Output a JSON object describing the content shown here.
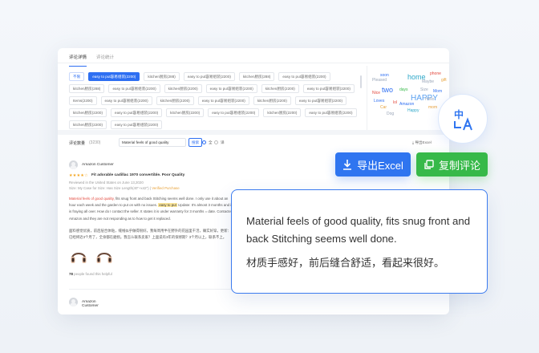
{
  "tabs": [
    {
      "label": "评论详情"
    },
    {
      "label": "评论统计"
    }
  ],
  "tags": [
    "不限",
    "easy to put容易组装(2200)",
    "kitchen厨房(288)",
    "easy to put容易组装(2200)",
    "kitchen厨房(288)",
    "easy to put容易组装(2200)",
    "kitchen厨房(288)",
    "easy to put容易组装(2200)",
    "kitchen厨房(2200)",
    "easy to put容易组装(2200)",
    "kitchen厨房(2200)",
    "easy to put容易组装(2200)",
    "Items(2200)",
    "easy to put容易组装(2200)",
    "kitchen厨房(2200)",
    "easy to put容易组装(2200)",
    "kitchen厨房(2200)",
    "easy to put容易组装(2200)",
    "kitchen厨房(2200)",
    "easy to put容易组装(2200)",
    "kitchen厨房(2200)",
    "easy to put容易组装(2200)",
    "kitchen厨房(2200)",
    "easy to put容易组装(2200)",
    "kitchen厨房(2200)",
    "easy to put容易组装(2200)"
  ],
  "wordcloud": {
    "words": [
      {
        "text": "Pleased",
        "color": "#9aa6b8"
      },
      {
        "text": "soon",
        "color": "#2e6ff2"
      },
      {
        "text": "home",
        "color": "#2ea8c9"
      },
      {
        "text": "phone",
        "color": "#e2483d"
      },
      {
        "text": "Maybe",
        "color": "#9aa6b8"
      },
      {
        "text": "gift",
        "color": "#e8a23a"
      },
      {
        "text": "Mom",
        "color": "#2e6ff2"
      },
      {
        "text": "two",
        "color": "#2e6ff2"
      },
      {
        "text": "days",
        "color": "#37b949"
      },
      {
        "text": "Size",
        "color": "#9aa6b8"
      },
      {
        "text": "Loves",
        "color": "#2e6ff2"
      },
      {
        "text": "HAPPY",
        "color": "#5aa0f0"
      },
      {
        "text": "lol",
        "color": "#e2483d"
      },
      {
        "text": "Car",
        "color": "#e8a23a"
      },
      {
        "text": "Amazon",
        "color": "#2e6ff2"
      },
      {
        "text": "Happy",
        "color": "#2ea8c9"
      },
      {
        "text": "Dog",
        "color": "#9aa6b8"
      },
      {
        "text": "mom",
        "color": "#e8a23a"
      },
      {
        "text": "Nice",
        "color": "#e2483d"
      },
      {
        "text": "Hello",
        "color": "#9aa6b8"
      }
    ]
  },
  "list_header": {
    "title": "评论数量",
    "count": "(3230)",
    "search_value": "Material feels of good quality",
    "search_button": "搜索",
    "option1": "全",
    "option2": "译",
    "export_link": "导出Excel"
  },
  "review": {
    "author": "Amazon Customer",
    "stars": "★★★★☆",
    "title": "Fit adorable cadillac 1970 convertible. Poor Quality",
    "meta": "Reviewed in the United States on June 13,2020",
    "variant_prefix": "Size: My Case for Size: Has Size Length(40\"+x42\") |",
    "variant_link": "Verified Purchase",
    "body_highlight": "Material feels of good quality,",
    "body_text1": " fits snug front and back Stitching seems well done. I only use it about an hour each week and the garden to put on with no issues.",
    "body_yellow": "easy to put",
    "body_text2": " Update: It's almost 3 months and it is fraying all over. How do I contact the seller. It states it is under warranty for 3 months = date. Contacted Amazon and they are not responding as to how to get it replaced.",
    "body_cn": "面料感觉优质，前后层合体贴，缝线似乎做得很好。我每周用半在野外的花园里干活，确实好穿。更新：已经将近3个月了，全身都在磨损。我怎么联系卖家？上面说有3年的保修期？3个月以上，联系不上。",
    "helpful": "people found this helpful",
    "helpful_count": "78"
  },
  "review2": {
    "author": "Amazon Customer"
  },
  "actions": {
    "export_label": "导出Excel",
    "copy_label": "复制评论"
  },
  "translation": {
    "en": "Material feels of good quality, fits snug front and back Stitching seems well done.",
    "cn": "材质手感好，前后缝合舒适，看起来很好。"
  },
  "colors": {
    "primary": "#2f75f0",
    "success": "#37b949",
    "highlight": "#e2483d",
    "star": "#f3a41c"
  }
}
